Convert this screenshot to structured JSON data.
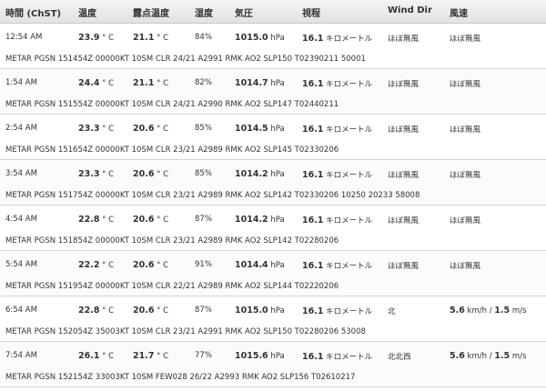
{
  "headers": {
    "time": "時間 (ChST)",
    "temp": "温度",
    "dew": "露点温度",
    "humidity": "湿度",
    "pressure": "気圧",
    "visibility": "視程",
    "wind_dir": "Wind Dir",
    "wind_speed": "風速"
  },
  "units": {
    "deg": "° C",
    "hpa": "hPa",
    "km": "キロメートル",
    "speed": "km/h /",
    "ms": "m/s"
  },
  "rows": [
    {
      "time": "12:54 AM",
      "temp": "23.9",
      "dew": "21.1",
      "humidity": "84%",
      "pressure": "1015.0",
      "visibility": "16.1",
      "wind_dir": "ほぼ無風",
      "wind_speed": "ほぼ無風",
      "speed_val": "",
      "ms_val": "",
      "metar": "METAR PGSN 151454Z 00000KT 10SM CLR 24/21 A2991 RMK AO2 SLP150 T02390211 50001"
    },
    {
      "time": "1:54 AM",
      "temp": "24.4",
      "dew": "21.1",
      "humidity": "82%",
      "pressure": "1014.7",
      "visibility": "16.1",
      "wind_dir": "ほぼ無風",
      "wind_speed": "ほぼ無風",
      "speed_val": "",
      "ms_val": "",
      "metar": "METAR PGSN 151554Z 00000KT 10SM CLR 24/21 A2990 RMK AO2 SLP147 T02440211"
    },
    {
      "time": "2:54 AM",
      "temp": "23.3",
      "dew": "20.6",
      "humidity": "85%",
      "pressure": "1014.5",
      "visibility": "16.1",
      "wind_dir": "ほぼ無風",
      "wind_speed": "ほぼ無風",
      "speed_val": "",
      "ms_val": "",
      "metar": "METAR PGSN 151654Z 00000KT 10SM CLR 23/21 A2989 RMK AO2 SLP145 T02330206"
    },
    {
      "time": "3:54 AM",
      "temp": "23.3",
      "dew": "20.6",
      "humidity": "85%",
      "pressure": "1014.2",
      "visibility": "16.1",
      "wind_dir": "ほぼ無風",
      "wind_speed": "ほぼ無風",
      "speed_val": "",
      "ms_val": "",
      "metar": "METAR PGSN 151754Z 00000KT 10SM CLR 23/21 A2989 RMK AO2 SLP142 T02330206 10250 20233 58008"
    },
    {
      "time": "4:54 AM",
      "temp": "22.8",
      "dew": "20.6",
      "humidity": "87%",
      "pressure": "1014.2",
      "visibility": "16.1",
      "wind_dir": "ほぼ無風",
      "wind_speed": "ほぼ無風",
      "speed_val": "",
      "ms_val": "",
      "metar": "METAR PGSN 151854Z 00000KT 10SM CLR 23/21 A2989 RMK AO2 SLP142 T02280206"
    },
    {
      "time": "5:54 AM",
      "temp": "22.2",
      "dew": "20.6",
      "humidity": "91%",
      "pressure": "1014.4",
      "visibility": "16.1",
      "wind_dir": "ほぼ無風",
      "wind_speed": "ほぼ無風",
      "speed_val": "",
      "ms_val": "",
      "metar": "METAR PGSN 151954Z 00000KT 10SM CLR 22/21 A2989 RMK AO2 SLP144 T02220206"
    },
    {
      "time": "6:54 AM",
      "temp": "22.8",
      "dew": "20.6",
      "humidity": "87%",
      "pressure": "1015.0",
      "visibility": "16.1",
      "wind_dir": "北",
      "wind_speed": "",
      "speed_val": "5.6",
      "ms_val": "1.5",
      "metar": "METAR PGSN 152054Z 35003KT 10SM CLR 23/21 A2991 RMK AO2 SLP150 T02280206 53008"
    },
    {
      "time": "7:54 AM",
      "temp": "26.1",
      "dew": "21.7",
      "humidity": "77%",
      "pressure": "1015.6",
      "visibility": "16.1",
      "wind_dir": "北北西",
      "wind_speed": "",
      "speed_val": "5.6",
      "ms_val": "1.5",
      "metar": "METAR PGSN 152154Z 33003KT 10SM FEW028 26/22 A2993 RMK AO2 SLP156 T02610217"
    }
  ]
}
